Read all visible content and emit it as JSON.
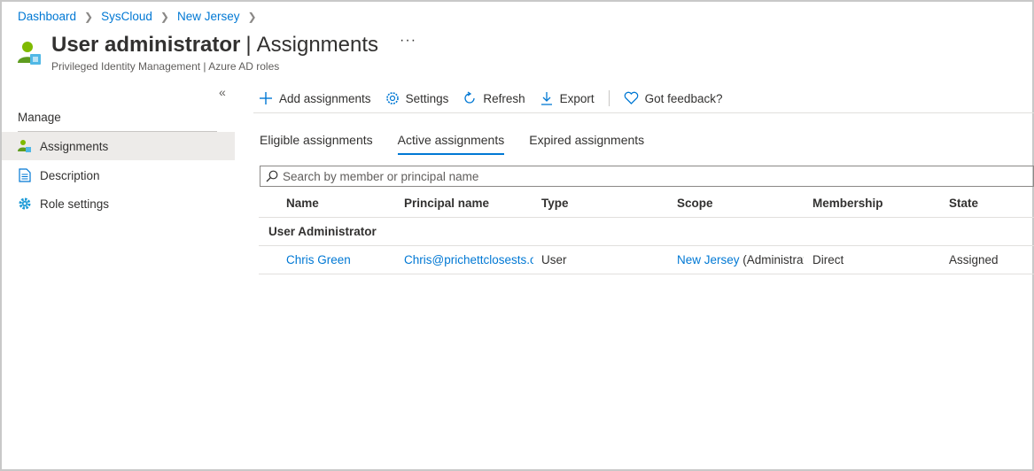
{
  "breadcrumb": [
    "Dashboard",
    "SysCloud",
    "New Jersey"
  ],
  "header": {
    "title": "User administrator",
    "title_separator": "|",
    "title_section": "Assignments",
    "more": "···",
    "subtitle": "Privileged Identity Management | Azure AD roles"
  },
  "sidebar": {
    "collapse": "«",
    "heading": "Manage",
    "items": [
      {
        "label": "Assignments",
        "icon": "users-icon",
        "active": true
      },
      {
        "label": "Description",
        "icon": "document-icon",
        "active": false
      },
      {
        "label": "Role settings",
        "icon": "gear-icon",
        "active": false
      }
    ]
  },
  "toolbar": {
    "add": "Add assignments",
    "settings": "Settings",
    "refresh": "Refresh",
    "export": "Export",
    "feedback": "Got feedback?"
  },
  "tabs": [
    "Eligible assignments",
    "Active assignments",
    "Expired assignments"
  ],
  "active_tab_index": 1,
  "search": {
    "placeholder": "Search by member or principal name",
    "value": ""
  },
  "table": {
    "columns": [
      "Name",
      "Principal name",
      "Type",
      "Scope",
      "Membership",
      "State"
    ],
    "group": "User Administrator",
    "rows": [
      {
        "name": "Chris Green",
        "principal": "Chris@prichettclosests.or",
        "type": "User",
        "scope_link": "New Jersey",
        "scope_rest": " (Administrativ",
        "membership": "Direct",
        "state": "Assigned"
      }
    ]
  },
  "colors": {
    "accent": "#0078d4",
    "text": "#323130",
    "selected_bg": "#edebe9"
  }
}
